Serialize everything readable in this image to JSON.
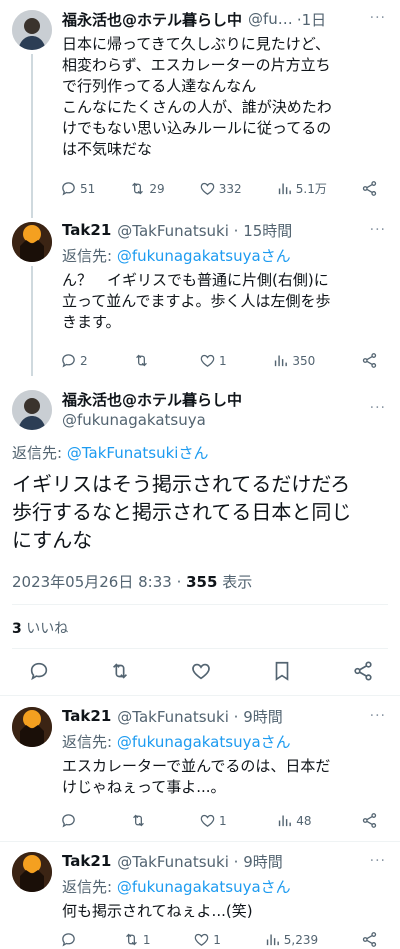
{
  "tweets": [
    {
      "name": "福永活也@ホテル暮らし中",
      "handle": "@fu…",
      "time": "·1日",
      "text": "日本に帰ってきて久しぶりに見たけど、\n相変わらず、エスカレーターの片方立ち\nで行列作ってる人達なんなん\nこんなにたくさんの人が、誰が決めたわ\nけでもない思い込みルールに従ってるの\nは不気味だな",
      "replies": "51",
      "retweets": "29",
      "likes": "332",
      "views": "5.1万"
    },
    {
      "name": "Tak21",
      "handle": "@TakFunatsuki · 15時間",
      "reply_prefix": "返信先: ",
      "reply_target": "@fukunagakatsuyaさん",
      "text": "ん？　イギリスでも普通に片側(右側)に\n立って並んでますよ。歩く人は左側を歩\nきます。",
      "replies": "2",
      "retweets": "",
      "likes": "1",
      "views": "350"
    }
  ],
  "main": {
    "name": "福永活也@ホテル暮らし中",
    "handle": "@fukunagakatsuya",
    "reply_prefix": "返信先: ",
    "reply_target": "@TakFunatsukiさん",
    "text": "イギリスはそう掲示されてるだけだろ\n歩行するなと掲示されてる日本と同じ\nにすんな",
    "timestamp": "2023年05月26日 8:33 · ",
    "views_count": "355",
    "views_label": " 表示",
    "likes_count": "3",
    "likes_label": " いいね"
  },
  "replies": [
    {
      "name": "Tak21",
      "handle": "@TakFunatsuki · 9時間",
      "reply_prefix": "返信先: ",
      "reply_target": "@fukunagakatsuyaさん",
      "text": "エスカレーターで並んでるのは、日本だ\nけじゃねぇって事よ...。",
      "replies": "",
      "retweets": "",
      "likes": "1",
      "views": "48"
    },
    {
      "name": "Tak21",
      "handle": "@TakFunatsuki · 9時間",
      "reply_prefix": "返信先: ",
      "reply_target": "@fukunagakatsuyaさん",
      "text": "何も掲示されてねぇよ...(笑)",
      "replies": "",
      "retweets": "1",
      "likes": "1",
      "views": "5,239"
    }
  ],
  "icons": [
    "reply-icon",
    "retweet-icon",
    "like-icon",
    "views-icon",
    "share-icon",
    "bookmark-icon",
    "more-icon"
  ],
  "colors": {
    "link": "#1d9bf0",
    "muted": "#536471",
    "text": "#0f1419",
    "line": "#cfd9de"
  }
}
